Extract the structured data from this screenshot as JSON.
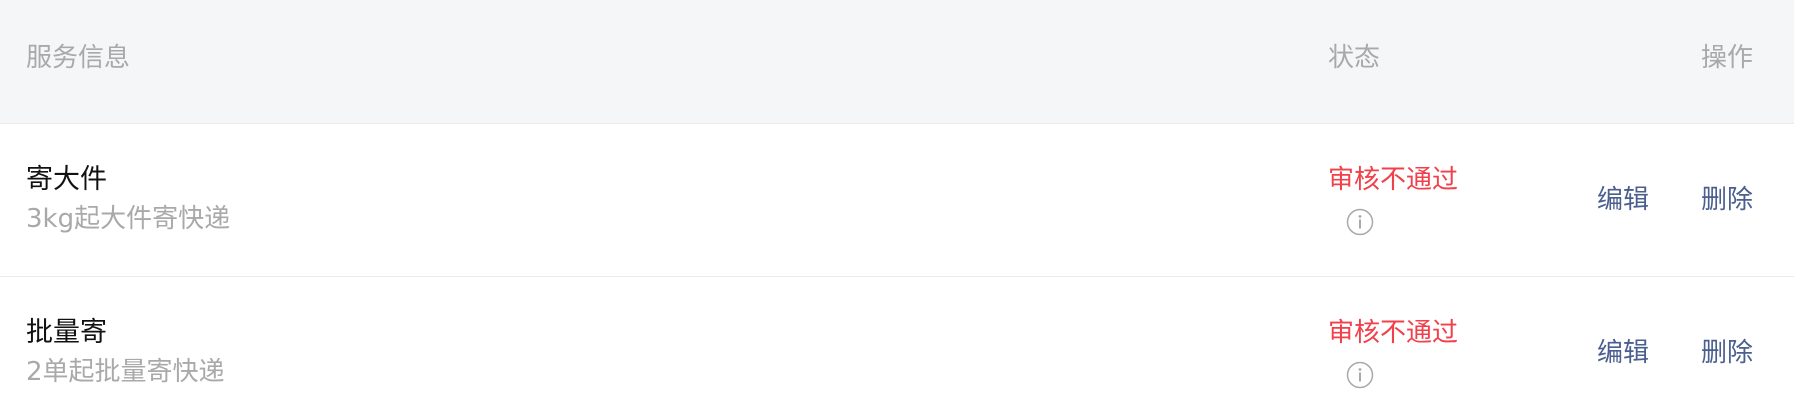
{
  "header": {
    "service_info": "服务信息",
    "status": "状态",
    "actions": "操作"
  },
  "rows": [
    {
      "title": "寄大件",
      "description": "3kg起大件寄快递",
      "status": "审核不通过",
      "status_icon": "info-icon",
      "edit_label": "编辑",
      "delete_label": "删除"
    },
    {
      "title": "批量寄",
      "description": "2单起批量寄快递",
      "status": "审核不通过",
      "status_icon": "info-icon",
      "edit_label": "编辑",
      "delete_label": "删除"
    }
  ],
  "colors": {
    "header_bg": "#f5f6f8",
    "status_rejected": "#f2404a",
    "action_link": "#4a5f8e",
    "muted_text": "#a9a9a9"
  }
}
